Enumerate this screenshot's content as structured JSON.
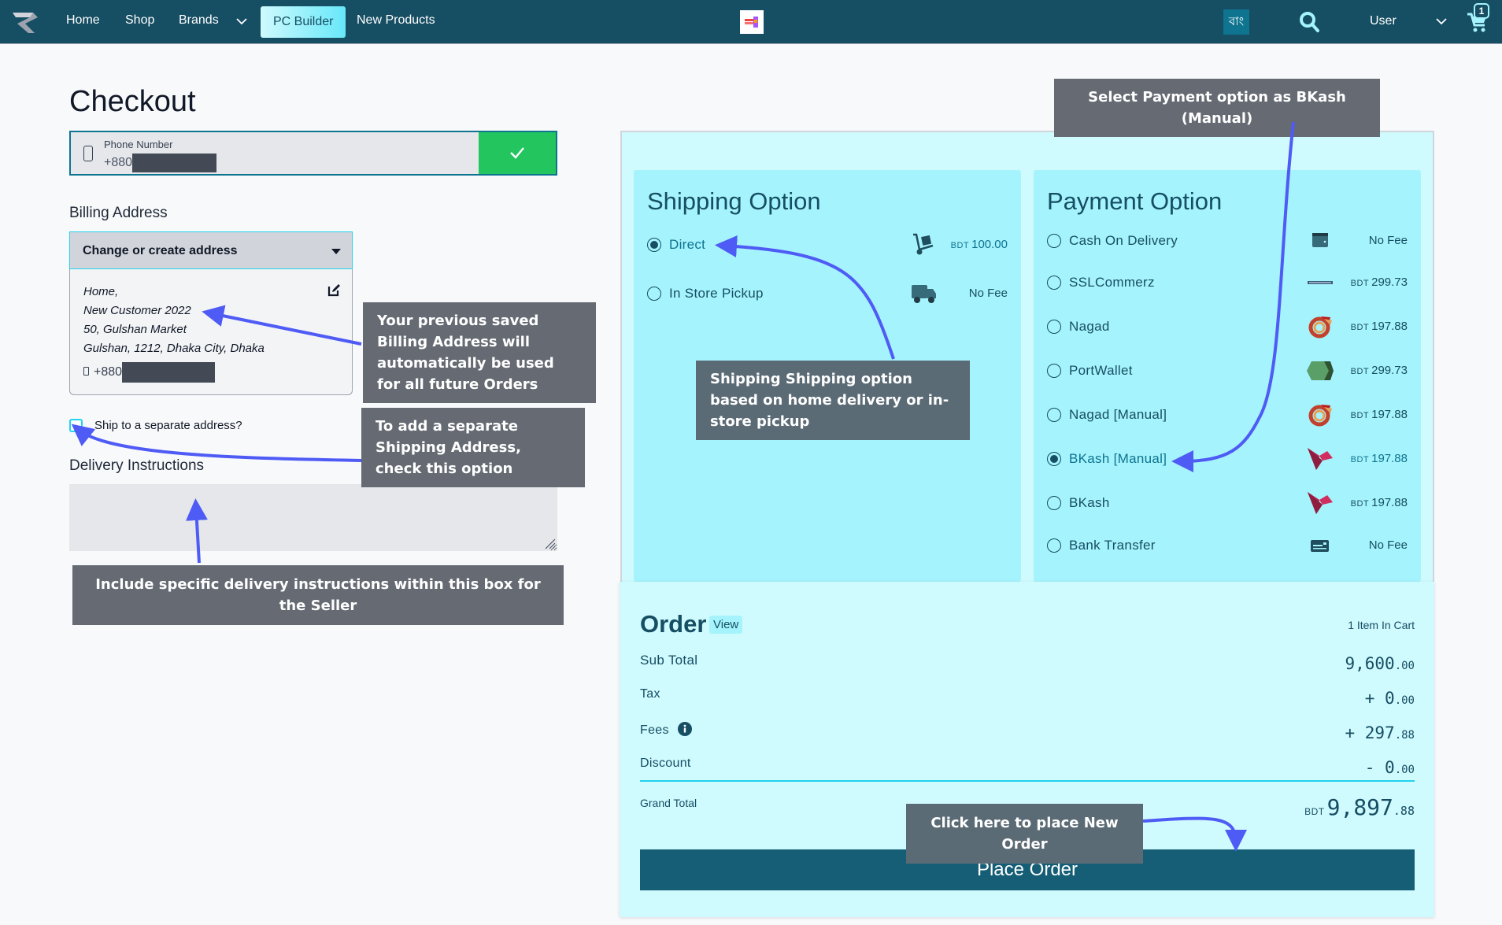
{
  "navbar": {
    "logo_icon": "brand-logo-icon",
    "items": [
      {
        "label": "Home"
      },
      {
        "label": "Shop"
      },
      {
        "label": "Brands"
      },
      {
        "label": "PC Builder",
        "active": true
      },
      {
        "label": "New Products"
      }
    ],
    "center_logo_icon": "store-logo-icon",
    "theme_icon": "theme-toggle-icon",
    "language_label": "বাং",
    "search_icon": "search-icon",
    "user_label": "User",
    "cart_icon": "cart-icon",
    "cart_count": "1"
  },
  "checkout": {
    "title": "Checkout",
    "phone": {
      "label": "Phone Number",
      "prefix": "+880",
      "confirm_icon": "check-icon"
    },
    "billing": {
      "label": "Billing Address",
      "select_label": "Change or create address",
      "address_lines": [
        "Home,",
        "New Customer 2022",
        "50, Gulshan Market",
        "Gulshan, 1212, Dhaka City, Dhaka"
      ],
      "phone_prefix": "+880"
    },
    "ship_separate_label": "Ship to a separate address?",
    "delivery_label": "Delivery Instructions",
    "delivery_value": ""
  },
  "shipping": {
    "title": "Shipping Option",
    "options": [
      {
        "label": "Direct",
        "icon": "hand-truck-icon",
        "currency": "BDT",
        "fee": "100.00",
        "selected": true
      },
      {
        "label": "In Store Pickup",
        "icon": "delivery-truck-icon",
        "currency": "",
        "fee": "No Fee",
        "selected": false
      }
    ]
  },
  "payment": {
    "title": "Payment Option",
    "options": [
      {
        "label": "Cash On Delivery",
        "icon": "wallet-icon",
        "currency": "",
        "fee": "No Fee",
        "selected": false
      },
      {
        "label": "SSLCommerz",
        "icon": "sslcommerz-logo-icon",
        "currency": "BDT",
        "fee": "299.73",
        "selected": false
      },
      {
        "label": "Nagad",
        "icon": "nagad-logo-icon",
        "currency": "BDT",
        "fee": "197.88",
        "selected": false
      },
      {
        "label": "PortWallet",
        "icon": "portwallet-logo-icon",
        "currency": "BDT",
        "fee": "299.73",
        "selected": false
      },
      {
        "label": "Nagad [Manual]",
        "icon": "nagad-logo-icon",
        "currency": "BDT",
        "fee": "197.88",
        "selected": false
      },
      {
        "label": "BKash [Manual]",
        "icon": "bkash-logo-icon",
        "currency": "BDT",
        "fee": "197.88",
        "selected": true
      },
      {
        "label": "BKash",
        "icon": "bkash-logo-icon",
        "currency": "BDT",
        "fee": "197.88",
        "selected": false
      },
      {
        "label": "Bank Transfer",
        "icon": "bank-card-icon",
        "currency": "",
        "fee": "No Fee",
        "selected": false
      }
    ]
  },
  "order": {
    "title": "Order",
    "view_label": "View",
    "items_count": "1 Item In Cart",
    "rows": [
      {
        "label": "Sub Total",
        "sign": "",
        "int": "9,600",
        "dec": ".00"
      },
      {
        "label": "Tax",
        "sign": "+ ",
        "int": "0",
        "dec": ".00"
      },
      {
        "label": "Fees",
        "sign": "+ ",
        "int": "297",
        "dec": ".88",
        "info_icon": "info-icon"
      },
      {
        "label": "Discount",
        "sign": "- ",
        "int": "0",
        "dec": ".00"
      }
    ],
    "grand_total_label": "Grand Total",
    "grand_total_currency": "BDT",
    "grand_total_int": "9,897",
    "grand_total_dec": ".88",
    "place_order_label": "Place Order"
  },
  "annotations": {
    "payment_hint": "Select Payment option as BKash (Manual)",
    "billing_hint": "Your previous saved Billing Address will automatically be used for all future Orders",
    "ship_separate_hint": "To add a separate Shipping Address, check this option",
    "delivery_hint": "Include specific delivery instructions within this box for the Seller",
    "shipping_hint": "Shipping Shipping option based on home delivery or in-store pickup",
    "place_order_hint": "Click here to place New Order",
    "arrow_color": "#4f5bf5"
  },
  "colors": {
    "navbar": "#164e63",
    "accent": "#0e7490",
    "panel": "#cffafe",
    "block": "#a5f3fc",
    "confirm": "#22c55e",
    "place_order": "#155e75"
  }
}
